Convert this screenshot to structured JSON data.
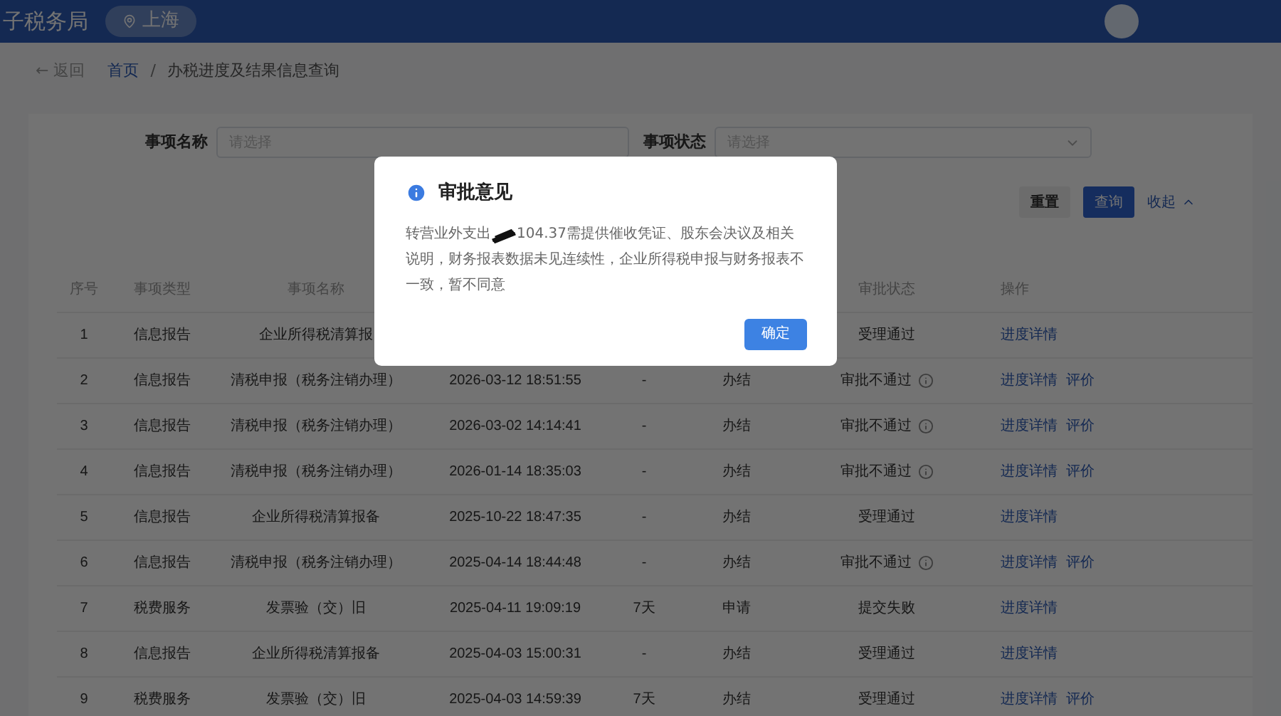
{
  "header": {
    "title": "子税务局",
    "region": "上海"
  },
  "breadcrumb": {
    "back": "← 返回",
    "separator": "/",
    "items": [
      "首页",
      "办税进度及结果信息查询"
    ]
  },
  "filters": [
    {
      "label": "事项名称",
      "placeholder": "请选择",
      "kind": "text"
    },
    {
      "label": "事项状态",
      "placeholder": "请选择",
      "kind": "select"
    }
  ],
  "buttons": {
    "reset": "重置",
    "search": "查询",
    "collapse": "收起"
  },
  "table": {
    "columns": [
      "序号",
      "事项类型",
      "事项名称",
      "",
      "",
      "",
      "审批状态",
      "操作"
    ],
    "rows": [
      {
        "cells": [
          "1",
          "信息报告",
          "企业所得税清算报",
          "",
          "",
          ""
        ],
        "status": "受理通过",
        "info": false,
        "actions": [
          "进度详情"
        ]
      },
      {
        "cells": [
          "2",
          "信息报告",
          "清税申报（税务注销办理）",
          "2026-03-12 18:51:55",
          "-",
          "办结"
        ],
        "status": "审批不通过",
        "info": true,
        "actions": [
          "进度详情",
          "评价"
        ]
      },
      {
        "cells": [
          "3",
          "信息报告",
          "清税申报（税务注销办理）",
          "2026-03-02 14:14:41",
          "-",
          "办结"
        ],
        "status": "审批不通过",
        "info": true,
        "actions": [
          "进度详情",
          "评价"
        ]
      },
      {
        "cells": [
          "4",
          "信息报告",
          "清税申报（税务注销办理）",
          "2026-01-14 18:35:03",
          "-",
          "办结"
        ],
        "status": "审批不通过",
        "info": true,
        "actions": [
          "进度详情",
          "评价"
        ]
      },
      {
        "cells": [
          "5",
          "信息报告",
          "企业所得税清算报备",
          "2025-10-22 18:47:35",
          "-",
          "办结"
        ],
        "status": "受理通过",
        "info": false,
        "actions": [
          "进度详情"
        ]
      },
      {
        "cells": [
          "6",
          "信息报告",
          "清税申报（税务注销办理）",
          "2025-04-14 18:44:48",
          "-",
          "办结"
        ],
        "status": "审批不通过",
        "info": true,
        "actions": [
          "进度详情",
          "评价"
        ]
      },
      {
        "cells": [
          "7",
          "税费服务",
          "发票验（交）旧",
          "2025-04-11 19:09:19",
          "7天",
          "申请"
        ],
        "status": "提交失败",
        "info": false,
        "actions": [
          "进度详情"
        ]
      },
      {
        "cells": [
          "8",
          "信息报告",
          "企业所得税清算报备",
          "2025-04-03 15:00:31",
          "-",
          "办结"
        ],
        "status": "受理通过",
        "info": false,
        "actions": [
          "进度详情"
        ]
      },
      {
        "cells": [
          "9",
          "税费服务",
          "发票验（交）旧",
          "2025-04-03 14:59:39",
          "7天",
          "办结"
        ],
        "status": "受理通过",
        "info": false,
        "actions": [
          "进度详情",
          "评价"
        ]
      }
    ]
  },
  "dialog": {
    "title": "审批意见",
    "message_before": "转营业外支出",
    "redacted": true,
    "message_after": "104.37需提供催收凭证、股东会决议及相关说明，财务报表数据未见连续性，企业所得税申报与财务报表不一致，暂不同意",
    "confirm": "确定"
  }
}
